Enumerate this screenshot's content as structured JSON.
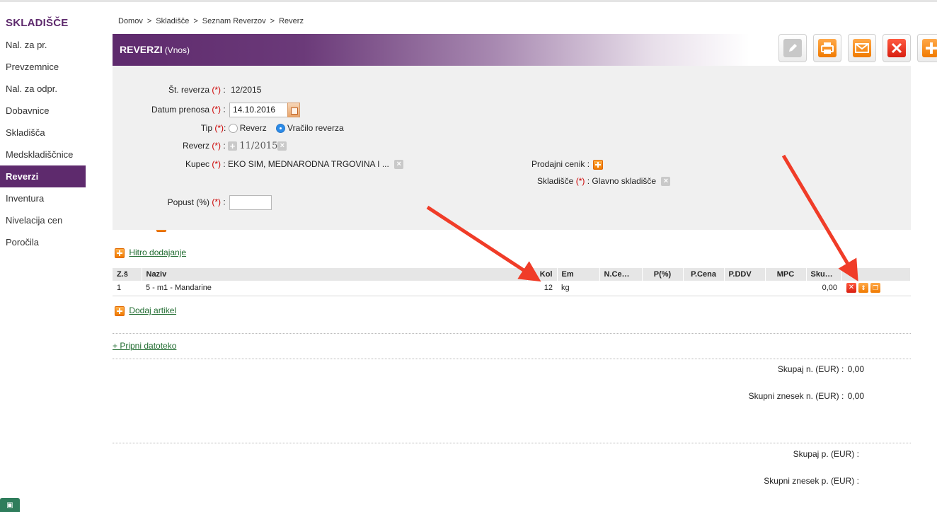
{
  "sidebar": {
    "title": "SKLADIŠČE",
    "items": [
      {
        "label": "Nal. za pr.",
        "has_add": true
      },
      {
        "label": "Prevzemnice",
        "has_add": true
      },
      {
        "label": "Nal. za odpr.",
        "has_add": true
      },
      {
        "label": "Dobavnice",
        "has_add": true
      },
      {
        "label": "Skladišča",
        "has_add": true
      },
      {
        "label": "Medskladiščnice",
        "has_add": true
      },
      {
        "label": "Reverzi",
        "has_add": true,
        "active": true
      },
      {
        "label": "Inventura",
        "has_add": true
      },
      {
        "label": "Nivelacija cen",
        "has_add": true
      },
      {
        "label": "Poročila",
        "has_add": false
      }
    ]
  },
  "breadcrumb": {
    "items": [
      "Domov",
      "Skladišče",
      "Seznam Reverzov",
      "Reverz"
    ],
    "separator": ">"
  },
  "header": {
    "title": "REVERZI",
    "subtitle": "(Vnos)"
  },
  "toolbar": {
    "edit_icon": "pencil-icon",
    "print_icon": "printer-icon",
    "email_icon": "envelope-icon",
    "delete_icon": "close-icon",
    "add_icon": "plus-icon"
  },
  "form": {
    "required_marker": "(*)",
    "st_reverza": {
      "label": "Št. reverza",
      "value": "12/2015"
    },
    "datum_prenosa": {
      "label": "Datum prenosa",
      "value": "14.10.2016"
    },
    "tip": {
      "label": "Tip",
      "option_1": "Reverz",
      "option_2": "Vračilo reverza",
      "selected": "Vračilo reverza"
    },
    "reverz": {
      "label": "Reverz",
      "value": "11/2015"
    },
    "kupec": {
      "label": "Kupec",
      "value": "EKO SIM, MEDNARODNA TRGOVINA I ..."
    },
    "prodajni_cenik": {
      "label": "Prodajni cenik :"
    },
    "skladisce": {
      "label": "Skladišče",
      "value": "Glavno skladišče"
    },
    "popust": {
      "label": "Popust (%)",
      "value": ""
    }
  },
  "quick_add": {
    "label": "Hitro dodajanje"
  },
  "table": {
    "headers": {
      "zs": "Z.š",
      "naziv": "Naziv",
      "kol": "Kol",
      "em": "Em",
      "ncena": "N.Ce…",
      "p_pct": "P(%)",
      "pcena": "P.Cena",
      "pddv": "P.DDV",
      "mpc": "MPC",
      "skupaj": "Sku…"
    },
    "rows": [
      {
        "zs": "1",
        "naziv": "5 - m1 - Mandarine",
        "kol": "12",
        "em": "kg",
        "ncena": "",
        "p_pct": "",
        "pcena": "",
        "pddv": "",
        "mpc": "",
        "skupaj": "0,00"
      }
    ]
  },
  "add_article": {
    "label": "Dodaj artikel"
  },
  "attach": {
    "label": "+ Pripni datoteko"
  },
  "totals": {
    "skupaj_n_label": "Skupaj n. (EUR) :",
    "skupaj_n_value": "0,00",
    "znesek_n_label": "Skupni znesek n. (EUR) :",
    "znesek_n_value": "0,00",
    "skupaj_p_label": "Skupaj p. (EUR) :",
    "skupaj_p_value": "",
    "znesek_p_label": "Skupni znesek p. (EUR) :",
    "znesek_p_value": ""
  },
  "colors": {
    "brand": "#5e2a6d",
    "accent_orange": "#f07a00",
    "delete_red": "#e02a1a",
    "annotation_arrow": "#f03c28"
  }
}
